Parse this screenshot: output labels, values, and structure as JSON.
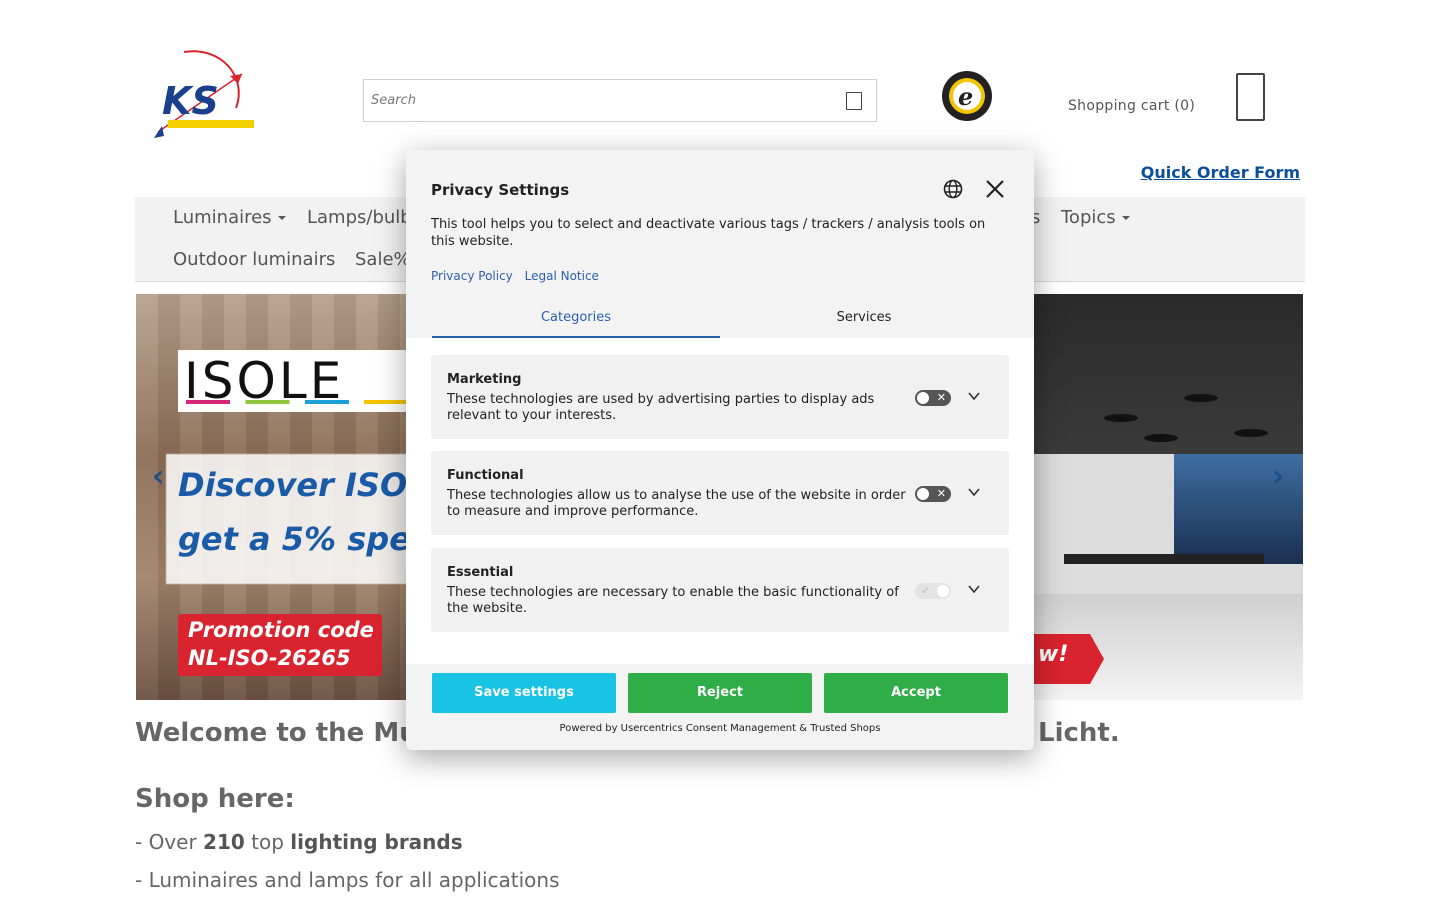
{
  "header": {
    "search_placeholder": "Search",
    "cart_label": "Shopping cart (0)",
    "quick_order_label": "Quick Order Form",
    "logo_text": "KS"
  },
  "nav": {
    "items": [
      {
        "label": "Luminaires",
        "has_caret": true
      },
      {
        "label": "Lamps/bulb",
        "has_caret": false
      },
      {
        "label": "s",
        "has_caret": false
      },
      {
        "label": "Topics",
        "has_caret": true
      },
      {
        "label": "Outdoor luminairs",
        "has_caret": false
      },
      {
        "label": "Sale%",
        "has_caret": false
      }
    ]
  },
  "banner": {
    "brand": "ISOLE",
    "line1": "Discover ISO",
    "line2": "get a 5% spe",
    "promo_line1": "Promotion code",
    "promo_line2": "NL-ISO-26265",
    "right_badge": "w!"
  },
  "content": {
    "welcome_left": "Welcome to the Mu",
    "welcome_right": "Licht.",
    "shop_here": "Shop here:",
    "bullet1_pre": "- Over ",
    "bullet1_num": "210",
    "bullet1_mid": " top ",
    "bullet1_bold": "lighting brands",
    "bullet2": "- Luminaires and lamps for all applications"
  },
  "modal": {
    "title": "Privacy Settings",
    "description": "This tool helps you to select and deactivate various tags / trackers / analysis tools on this website.",
    "links": [
      "Privacy Policy",
      "Legal Notice"
    ],
    "tabs": [
      {
        "label": "Categories",
        "active": true
      },
      {
        "label": "Services",
        "active": false
      }
    ],
    "categories": [
      {
        "title": "Marketing",
        "description": "These technologies are used by advertising parties to display ads relevant to your interests.",
        "enabled": false
      },
      {
        "title": "Functional",
        "description": "These technologies allow us to analyse the use of the website in order to measure and improve performance.",
        "enabled": false
      },
      {
        "title": "Essential",
        "description": "These technologies are necessary to enable the basic functionality of the website.",
        "enabled": true
      }
    ],
    "buttons": {
      "save": "Save settings",
      "reject": "Reject",
      "accept": "Accept"
    },
    "powered_by": "Powered by Usercentrics Consent Management & Trusted Shops"
  },
  "colors": {
    "accent_blue": "#2d5fb0",
    "save_button": "#18c3e4",
    "reject_accept_button": "#2fad46",
    "quick_order_link": "#0b4f9c",
    "promo_red": "#d9232e"
  }
}
